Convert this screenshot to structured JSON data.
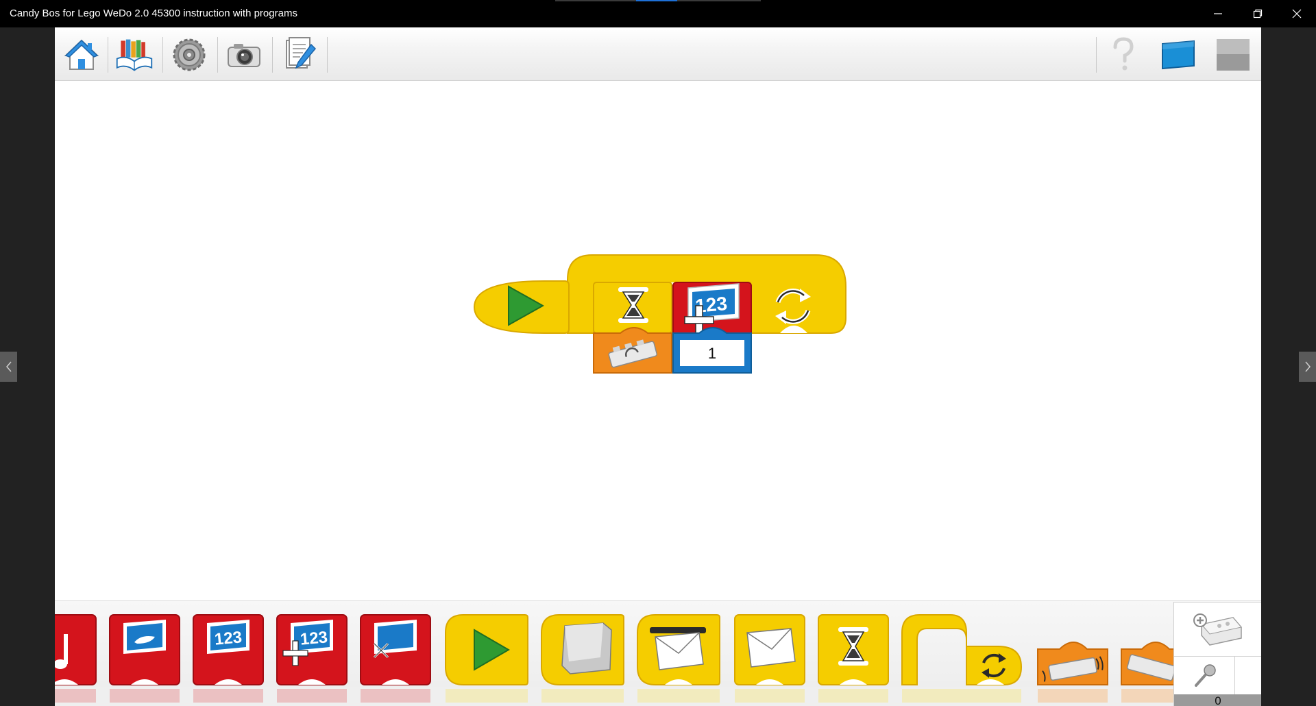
{
  "window": {
    "title": "Candy Bos for Lego WeDo 2.0 45300 instruction with programs",
    "controls": [
      "minimize",
      "restore",
      "close"
    ]
  },
  "toolbar": {
    "left_buttons": [
      "home-icon",
      "lobby-books-icon",
      "gear-settings-icon",
      "camera-icon",
      "documentation-icon"
    ],
    "right_buttons": [
      "help-icon",
      "display-blue-icon",
      "display-gray-icon"
    ]
  },
  "program": {
    "blocks": [
      "start-block",
      "repeat-loop-block",
      "wait-block",
      "add-to-display-block"
    ],
    "wait_input": "tilt-sensor-input",
    "display_value": "1",
    "display_number_label": "123"
  },
  "palette": {
    "blocks": [
      "sound-block",
      "display-image-block",
      "display-number-block",
      "add-to-display-block",
      "display-size-block",
      "start-block",
      "start-on-key-block",
      "start-on-message-block",
      "send-message-block",
      "wait-block",
      "repeat-loop-block",
      "motion-sensor-block",
      "tilt-sensor-block"
    ],
    "display_number_label": "123"
  },
  "hub_panel": {
    "add_hub_icon": "add-hub-icon",
    "microphone_icon": "microphone-icon",
    "count": "0"
  },
  "colors": {
    "yellow": "#f7d000",
    "red": "#d4141c",
    "orange": "#f08a1c",
    "blue": "#1a7ac8",
    "green": "#2e9a32"
  }
}
